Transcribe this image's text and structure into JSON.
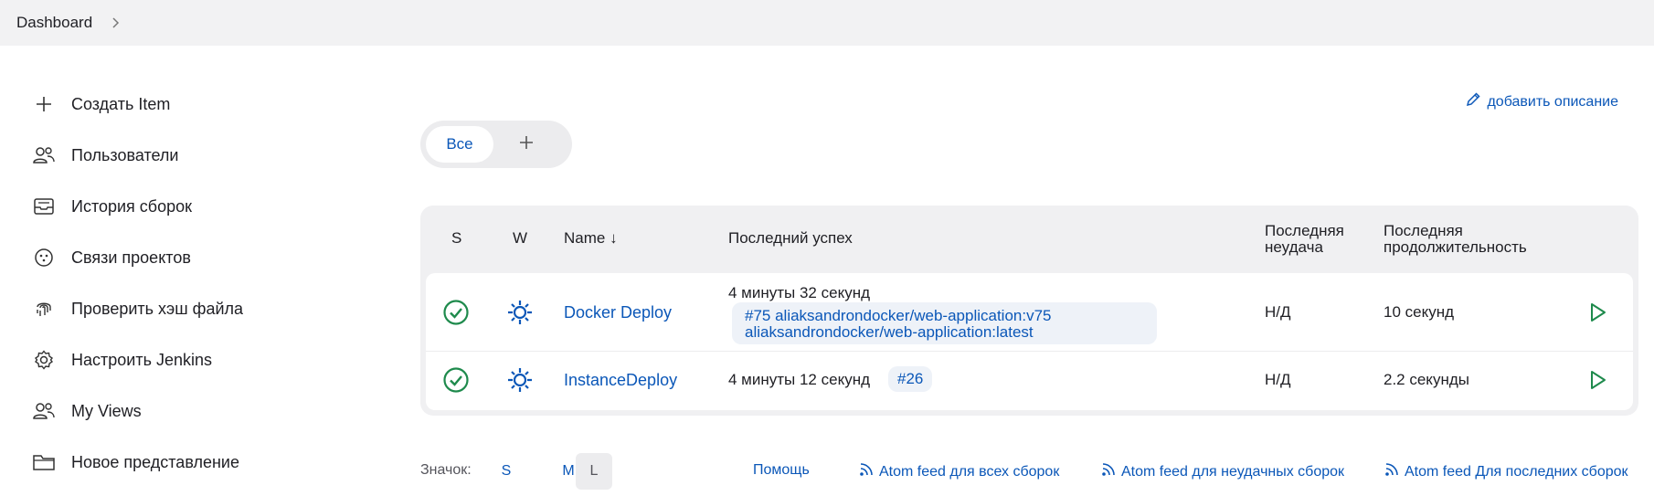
{
  "breadcrumb": {
    "root": "Dashboard"
  },
  "sidebar": {
    "items": [
      {
        "label": "Создать Item",
        "icon": "plus-icon"
      },
      {
        "label": "Пользователи",
        "icon": "users-icon"
      },
      {
        "label": "История сборок",
        "icon": "inbox-icon"
      },
      {
        "label": "Связи проектов",
        "icon": "relationship-icon"
      },
      {
        "label": "Проверить хэш файла",
        "icon": "fingerprint-icon"
      },
      {
        "label": "Настроить Jenkins",
        "icon": "settings-icon"
      },
      {
        "label": "My Views",
        "icon": "users-icon"
      },
      {
        "label": "Новое представление",
        "icon": "folder-icon"
      }
    ]
  },
  "actions": {
    "add_description": "добавить описание"
  },
  "tabs": {
    "all": "Все"
  },
  "table": {
    "headers": {
      "s": "S",
      "w": "W",
      "name": "Name ↓",
      "last_success": "Последний успех",
      "last_failure_1": "Последняя",
      "last_failure_2": "неудача",
      "last_duration_1": "Последняя",
      "last_duration_2": "продолжительность"
    },
    "rows": [
      {
        "name": "Docker Deploy",
        "last_success": "4 минуты 32 секунд",
        "build_line1": "#75 aliaksandrondocker/web-application:v75",
        "build_line2": "aliaksandrondocker/web-application:latest",
        "last_failure": "Н/Д",
        "last_duration": "10 секунд"
      },
      {
        "name": "InstanceDeploy",
        "last_success": "4 минуты 12 секунд",
        "build": "#26",
        "last_failure": "Н/Д",
        "last_duration": "2.2 секунды"
      }
    ]
  },
  "footer": {
    "icon_label": "Значок:",
    "sizes": [
      "S",
      "M",
      "L"
    ],
    "active_size": "L",
    "help": "Помощь",
    "feed_all": "Atom feed для всех сборок",
    "feed_failed": "Atom feed для неудачных сборок",
    "feed_latest": "Atom feed Для последних сборок"
  },
  "colors": {
    "link": "#0b57b8",
    "success": "#1e8a4c",
    "weather": "#0b57b8"
  }
}
